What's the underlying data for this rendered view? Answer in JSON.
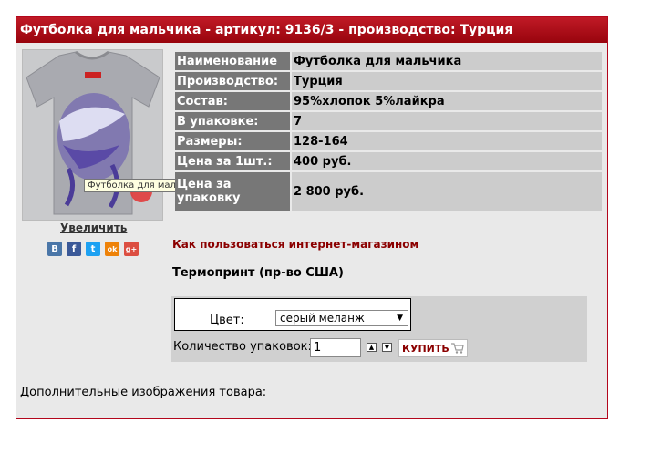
{
  "header": {
    "title": "Футболка для мальчика - артикул: 9136/3 - производство: Турция"
  },
  "photo": {
    "tooltip": "Футболка для мальчика",
    "zoom_label": "Увеличить"
  },
  "social": [
    {
      "name": "vk-icon",
      "glyph": "В",
      "color": "#4a76a8"
    },
    {
      "name": "facebook-icon",
      "glyph": "f",
      "color": "#3b5998"
    },
    {
      "name": "twitter-icon",
      "glyph": "t",
      "color": "#1da1f2"
    },
    {
      "name": "odnoklassniki-icon",
      "glyph": "ok",
      "color": "#ee8208"
    },
    {
      "name": "googleplus-icon",
      "glyph": "g+",
      "color": "#dc4e41"
    }
  ],
  "properties": [
    {
      "key": "Наименование",
      "value": "Футболка для мальчика"
    },
    {
      "key": "Производство:",
      "value": "Турция"
    },
    {
      "key": "Состав:",
      "value": "95%хлопок 5%лайкра"
    },
    {
      "key": "В упаковке:",
      "value": "7"
    },
    {
      "key": "Размеры:",
      "value": "128-164"
    },
    {
      "key": "Цена за 1шт.:",
      "value": "400 руб."
    },
    {
      "key": "Цена за упаковку",
      "value": "2 800 руб."
    }
  ],
  "links": {
    "howto": "Как пользоваться интернет-магазином"
  },
  "print_label": "Термопринт (пр-во США)",
  "order": {
    "color_label": "Цвет:",
    "color_value": "серый меланж",
    "qty_label": "Количество упаковок:",
    "qty_value": "1",
    "buy_label": "КУПИТЬ"
  },
  "extra_images_label": "Дополнительные изображения товара:"
}
